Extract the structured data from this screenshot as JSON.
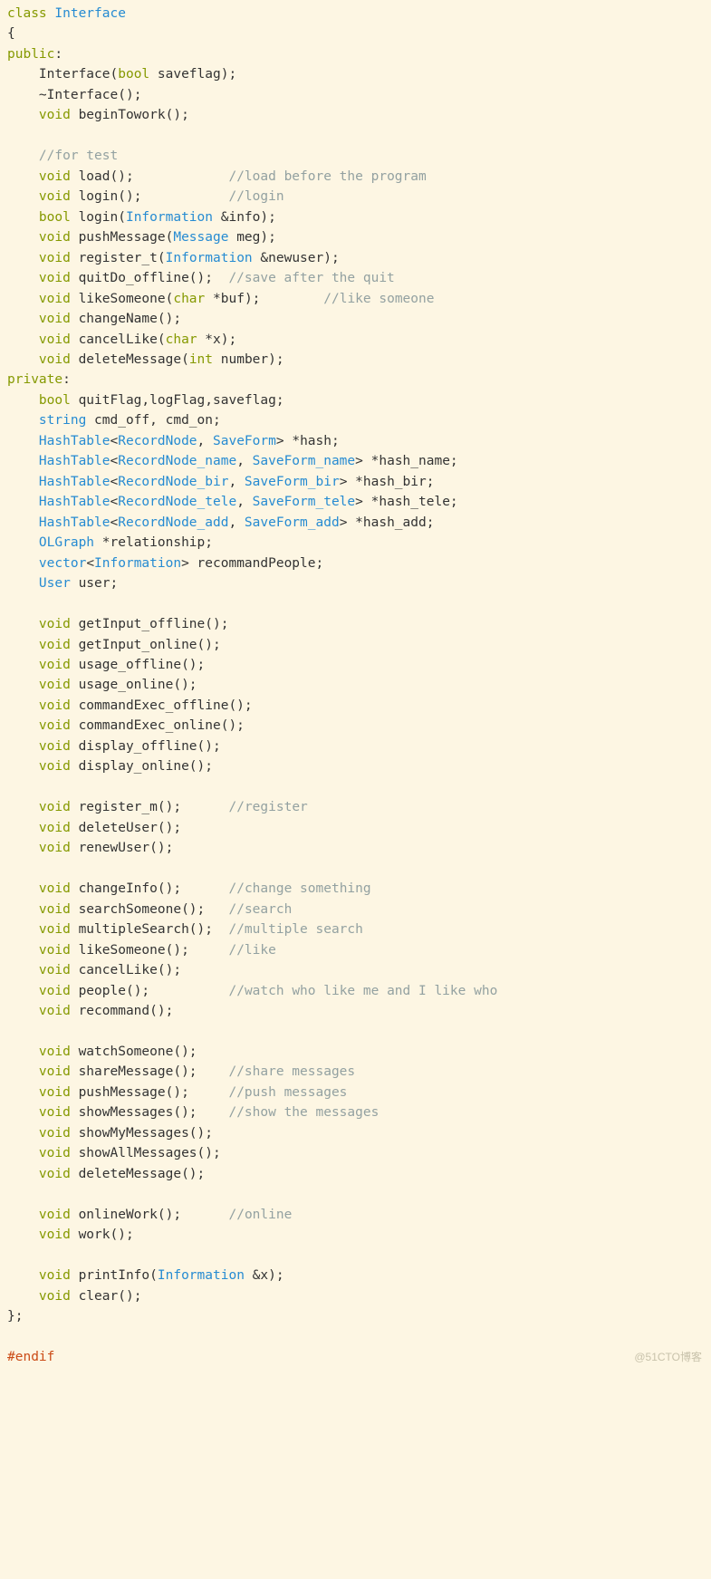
{
  "watermark": "@51CTO博客",
  "code": {
    "l1": {
      "kw": "class",
      "sp": " ",
      "type": "Interface"
    },
    "l2": {
      "brace": "{"
    },
    "l3": {
      "kw": "public",
      "colon": ":"
    },
    "l4": {
      "pad": "    ",
      "id": "Interface",
      "p1": "(",
      "kw": "bool",
      "sp": " ",
      "arg": "saveflag",
      "p2": ");"
    },
    "l5": {
      "pad": "    ",
      "id": "~Interface",
      "p": "();"
    },
    "l6": {
      "pad": "    ",
      "kw": "void",
      "sp": " ",
      "id": "beginTowork",
      "p": "();"
    },
    "l7": {
      "pad": "    "
    },
    "l8": {
      "pad": "    ",
      "cmt": "//for test"
    },
    "l9": {
      "pad": "    ",
      "kw": "void",
      "sp": " ",
      "id": "load",
      "p": "();",
      "gap": "            ",
      "cmt": "//load before the program"
    },
    "l10": {
      "pad": "    ",
      "kw": "void",
      "sp": " ",
      "id": "login",
      "p": "();",
      "gap": "           ",
      "cmt": "//login"
    },
    "l11": {
      "pad": "    ",
      "kw": "bool",
      "sp": " ",
      "id": "login",
      "p1": "(",
      "type": "Information",
      "sp2": " ",
      "amp": "&",
      "arg": "info",
      "p2": ");"
    },
    "l12": {
      "pad": "    ",
      "kw": "void",
      "sp": " ",
      "id": "pushMessage",
      "p1": "(",
      "type": "Message",
      "sp2": " ",
      "arg": "meg",
      "p2": ");"
    },
    "l13": {
      "pad": "    ",
      "kw": "void",
      "sp": " ",
      "id": "register_t",
      "p1": "(",
      "type": "Information",
      "sp2": " ",
      "amp": "&",
      "arg": "newuser",
      "p2": ");"
    },
    "l14": {
      "pad": "    ",
      "kw": "void",
      "sp": " ",
      "id": "quitDo_offline",
      "p": "();  ",
      "cmt": "//save after the quit"
    },
    "l15": {
      "pad": "    ",
      "kw": "void",
      "sp": " ",
      "id": "likeSomeone",
      "p1": "(",
      "kw2": "char",
      "sp2": " ",
      "ptr": "*",
      "arg": "buf",
      "p2": ");",
      "gap": "        ",
      "cmt": "//like someone"
    },
    "l16": {
      "pad": "    ",
      "kw": "void",
      "sp": " ",
      "id": "changeName",
      "p": "();"
    },
    "l17": {
      "pad": "    ",
      "kw": "void",
      "sp": " ",
      "id": "cancelLike",
      "p1": "(",
      "kw2": "char",
      "sp2": " ",
      "ptr": "*",
      "arg": "x",
      "p2": ");"
    },
    "l18": {
      "pad": "    ",
      "kw": "void",
      "sp": " ",
      "id": "deleteMessage",
      "p1": "(",
      "kw2": "int",
      "sp2": " ",
      "arg": "number",
      "p2": ");"
    },
    "l19": {
      "kw": "private",
      "colon": ":"
    },
    "l20": {
      "pad": "    ",
      "kw": "bool",
      "sp": " ",
      "id": "quitFlag,logFlag,saveflag;"
    },
    "l21": {
      "pad": "    ",
      "type": "string",
      "sp": " ",
      "id": "cmd_off, cmd_on;"
    },
    "l22": {
      "pad": "    ",
      "type": "HashTable",
      "lt": "<",
      "t1": "RecordNode",
      "c": ", ",
      "t2": "SaveForm",
      "gt": ">",
      "sp": " ",
      "ptr": "*",
      "id": "hash;"
    },
    "l23": {
      "pad": "    ",
      "type": "HashTable",
      "lt": "<",
      "t1": "RecordNode_name",
      "c": ", ",
      "t2": "SaveForm_name",
      "gt": ">",
      "sp": " ",
      "ptr": "*",
      "id": "hash_name;"
    },
    "l24": {
      "pad": "    ",
      "type": "HashTable",
      "lt": "<",
      "t1": "RecordNode_bir",
      "c": ", ",
      "t2": "SaveForm_bir",
      "gt": ">",
      "sp": " ",
      "ptr": "*",
      "id": "hash_bir;"
    },
    "l25": {
      "pad": "    ",
      "type": "HashTable",
      "lt": "<",
      "t1": "RecordNode_tele",
      "c": ", ",
      "t2": "SaveForm_tele",
      "gt": ">",
      "sp": " ",
      "ptr": "*",
      "id": "hash_tele;"
    },
    "l26": {
      "pad": "    ",
      "type": "HashTable",
      "lt": "<",
      "t1": "RecordNode_add",
      "c": ", ",
      "t2": "SaveForm_add",
      "gt": ">",
      "sp": " ",
      "ptr": "*",
      "id": "hash_add;"
    },
    "l27": {
      "pad": "    ",
      "type": "OLGraph",
      "sp": " ",
      "ptr": "*",
      "id": "relationship;"
    },
    "l28": {
      "pad": "    ",
      "type": "vector",
      "lt": "<",
      "t1": "Information",
      "gt": ">",
      "sp": " ",
      "id": "recommandPeople;"
    },
    "l29": {
      "pad": "    ",
      "type": "User",
      "sp": " ",
      "id": "user;"
    },
    "l30": {
      "pad": "    "
    },
    "l31": {
      "pad": "    ",
      "kw": "void",
      "sp": " ",
      "id": "getInput_offline",
      "p": "();"
    },
    "l32": {
      "pad": "    ",
      "kw": "void",
      "sp": " ",
      "id": "getInput_online",
      "p": "();"
    },
    "l33": {
      "pad": "    ",
      "kw": "void",
      "sp": " ",
      "id": "usage_offline",
      "p": "();"
    },
    "l34": {
      "pad": "    ",
      "kw": "void",
      "sp": " ",
      "id": "usage_online",
      "p": "();"
    },
    "l35": {
      "pad": "    ",
      "kw": "void",
      "sp": " ",
      "id": "commandExec_offline",
      "p": "();"
    },
    "l36": {
      "pad": "    ",
      "kw": "void",
      "sp": " ",
      "id": "commandExec_online",
      "p": "();"
    },
    "l37": {
      "pad": "    ",
      "kw": "void",
      "sp": " ",
      "id": "display_offline",
      "p": "();"
    },
    "l38": {
      "pad": "    ",
      "kw": "void",
      "sp": " ",
      "id": "display_online",
      "p": "();"
    },
    "l39": {
      "pad": "    "
    },
    "l40": {
      "pad": "    ",
      "kw": "void",
      "sp": " ",
      "id": "register_m",
      "p": "();",
      "gap": "      ",
      "cmt": "//register"
    },
    "l41": {
      "pad": "    ",
      "kw": "void",
      "sp": " ",
      "id": "deleteUser",
      "p": "();"
    },
    "l42": {
      "pad": "    ",
      "kw": "void",
      "sp": " ",
      "id": "renewUser",
      "p": "();"
    },
    "l43": {
      "pad": "    "
    },
    "l44": {
      "pad": "    ",
      "kw": "void",
      "sp": " ",
      "id": "changeInfo",
      "p": "();",
      "gap": "      ",
      "cmt": "//change something"
    },
    "l45": {
      "pad": "    ",
      "kw": "void",
      "sp": " ",
      "id": "searchSomeone",
      "p": "();",
      "gap": "   ",
      "cmt": "//search"
    },
    "l46": {
      "pad": "    ",
      "kw": "void",
      "sp": " ",
      "id": "multipleSearch",
      "p": "();",
      "gap": "  ",
      "cmt": "//multiple search"
    },
    "l47": {
      "pad": "    ",
      "kw": "void",
      "sp": " ",
      "id": "likeSomeone",
      "p": "();",
      "gap": "     ",
      "cmt": "//like"
    },
    "l48": {
      "pad": "    ",
      "kw": "void",
      "sp": " ",
      "id": "cancelLike",
      "p": "();"
    },
    "l49": {
      "pad": "    ",
      "kw": "void",
      "sp": " ",
      "id": "people",
      "p": "();",
      "gap": "          ",
      "cmt": "//watch who like me and I like who"
    },
    "l50": {
      "pad": "    ",
      "kw": "void",
      "sp": " ",
      "id": "recommand",
      "p": "();"
    },
    "l51": {
      "pad": "    "
    },
    "l52": {
      "pad": "    ",
      "kw": "void",
      "sp": " ",
      "id": "watchSomeone",
      "p": "();"
    },
    "l53": {
      "pad": "    ",
      "kw": "void",
      "sp": " ",
      "id": "shareMessage",
      "p": "();",
      "gap": "    ",
      "cmt": "//share messages"
    },
    "l54": {
      "pad": "    ",
      "kw": "void",
      "sp": " ",
      "id": "pushMessage",
      "p": "();",
      "gap": "     ",
      "cmt": "//push messages"
    },
    "l55": {
      "pad": "    ",
      "kw": "void",
      "sp": " ",
      "id": "showMessages",
      "p": "();",
      "gap": "    ",
      "cmt": "//show the messages"
    },
    "l56": {
      "pad": "    ",
      "kw": "void",
      "sp": " ",
      "id": "showMyMessages",
      "p": "();"
    },
    "l57": {
      "pad": "    ",
      "kw": "void",
      "sp": " ",
      "id": "showAllMessages",
      "p": "();"
    },
    "l58": {
      "pad": "    ",
      "kw": "void",
      "sp": " ",
      "id": "deleteMessage",
      "p": "();"
    },
    "l59": {
      "pad": "    "
    },
    "l60": {
      "pad": "    ",
      "kw": "void",
      "sp": " ",
      "id": "onlineWork",
      "p": "();",
      "gap": "      ",
      "cmt": "//online"
    },
    "l61": {
      "pad": "    ",
      "kw": "void",
      "sp": " ",
      "id": "work",
      "p": "();"
    },
    "l62": {
      "pad": "    "
    },
    "l63": {
      "pad": "    ",
      "kw": "void",
      "sp": " ",
      "id": "printInfo",
      "p1": "(",
      "type": "Information",
      "sp2": " ",
      "amp": "&",
      "arg": "x",
      "p2": ");"
    },
    "l64": {
      "pad": "    ",
      "kw": "void",
      "sp": " ",
      "id": "clear",
      "p": "();"
    },
    "l65": {
      "brace": "};"
    },
    "l66": {
      "blank": ""
    },
    "l67": {
      "directive": "#endif"
    }
  }
}
